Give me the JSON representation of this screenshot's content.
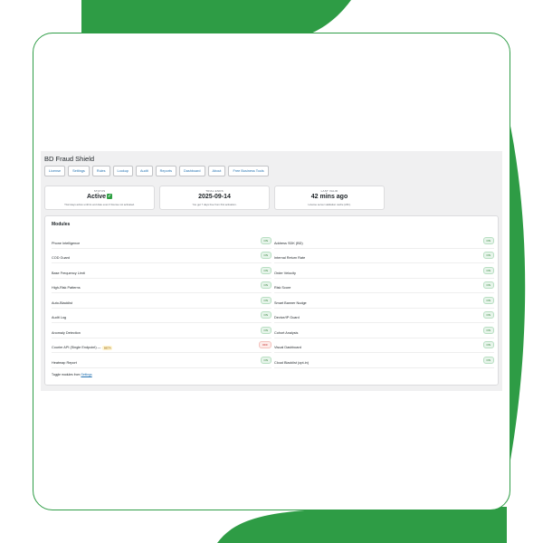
{
  "app": {
    "title": "BD Fraud Shield"
  },
  "nav": [
    "License",
    "Settings",
    "Rules",
    "Lookup",
    "Audit",
    "Reports",
    "Dashboard",
    "About",
    "Free Business Tools"
  ],
  "stats": [
    {
      "label": "STATUS",
      "value": "Active",
      "note": "Trial stays active until its end date even if license not activated."
    },
    {
      "label": "TRIAL ENDS",
      "value": "2025-09-14",
      "note": "You get 7 days free from first activation."
    },
    {
      "label": "LAST VALID",
      "value": "42 mins ago",
      "note": "License server validation cache (24h)."
    }
  ],
  "modules": {
    "title": "Modules",
    "left": [
      {
        "name": "Phone Intelligence",
        "state": "ON"
      },
      {
        "name": "COD Guard",
        "state": "ON"
      },
      {
        "name": "Base Frequency Limit",
        "state": "ON"
      },
      {
        "name": "High-Risk Patterns",
        "state": "ON"
      },
      {
        "name": "Auto-Blacklist",
        "state": "ON"
      },
      {
        "name": "Audit Log",
        "state": "ON"
      },
      {
        "name": "Anomaly Detection",
        "state": "ON"
      },
      {
        "name": "Courier API (Single Endpoint) —",
        "state": "OFF",
        "badge": "BETA"
      },
      {
        "name": "Heatmap Report",
        "state": "ON"
      }
    ],
    "right": [
      {
        "name": "Address SDK (BD)",
        "state": "ON"
      },
      {
        "name": "Internal Return Rate",
        "state": "ON"
      },
      {
        "name": "Order Velocity",
        "state": "ON"
      },
      {
        "name": "Risk Score",
        "state": "ON"
      },
      {
        "name": "Smart Banner Nudge",
        "state": "ON"
      },
      {
        "name": "Device/IP Guard",
        "state": "ON"
      },
      {
        "name": "Cohort Analysis",
        "state": "ON"
      },
      {
        "name": "Visual Dashboard",
        "state": "ON"
      },
      {
        "name": "Cloud Blacklist (opt-in)",
        "state": "ON"
      }
    ],
    "footer_prefix": "Toggle modules from",
    "footer_link": "Settings"
  },
  "colors": {
    "brand_green": "#2e9c45",
    "link_blue": "#2271b1"
  }
}
